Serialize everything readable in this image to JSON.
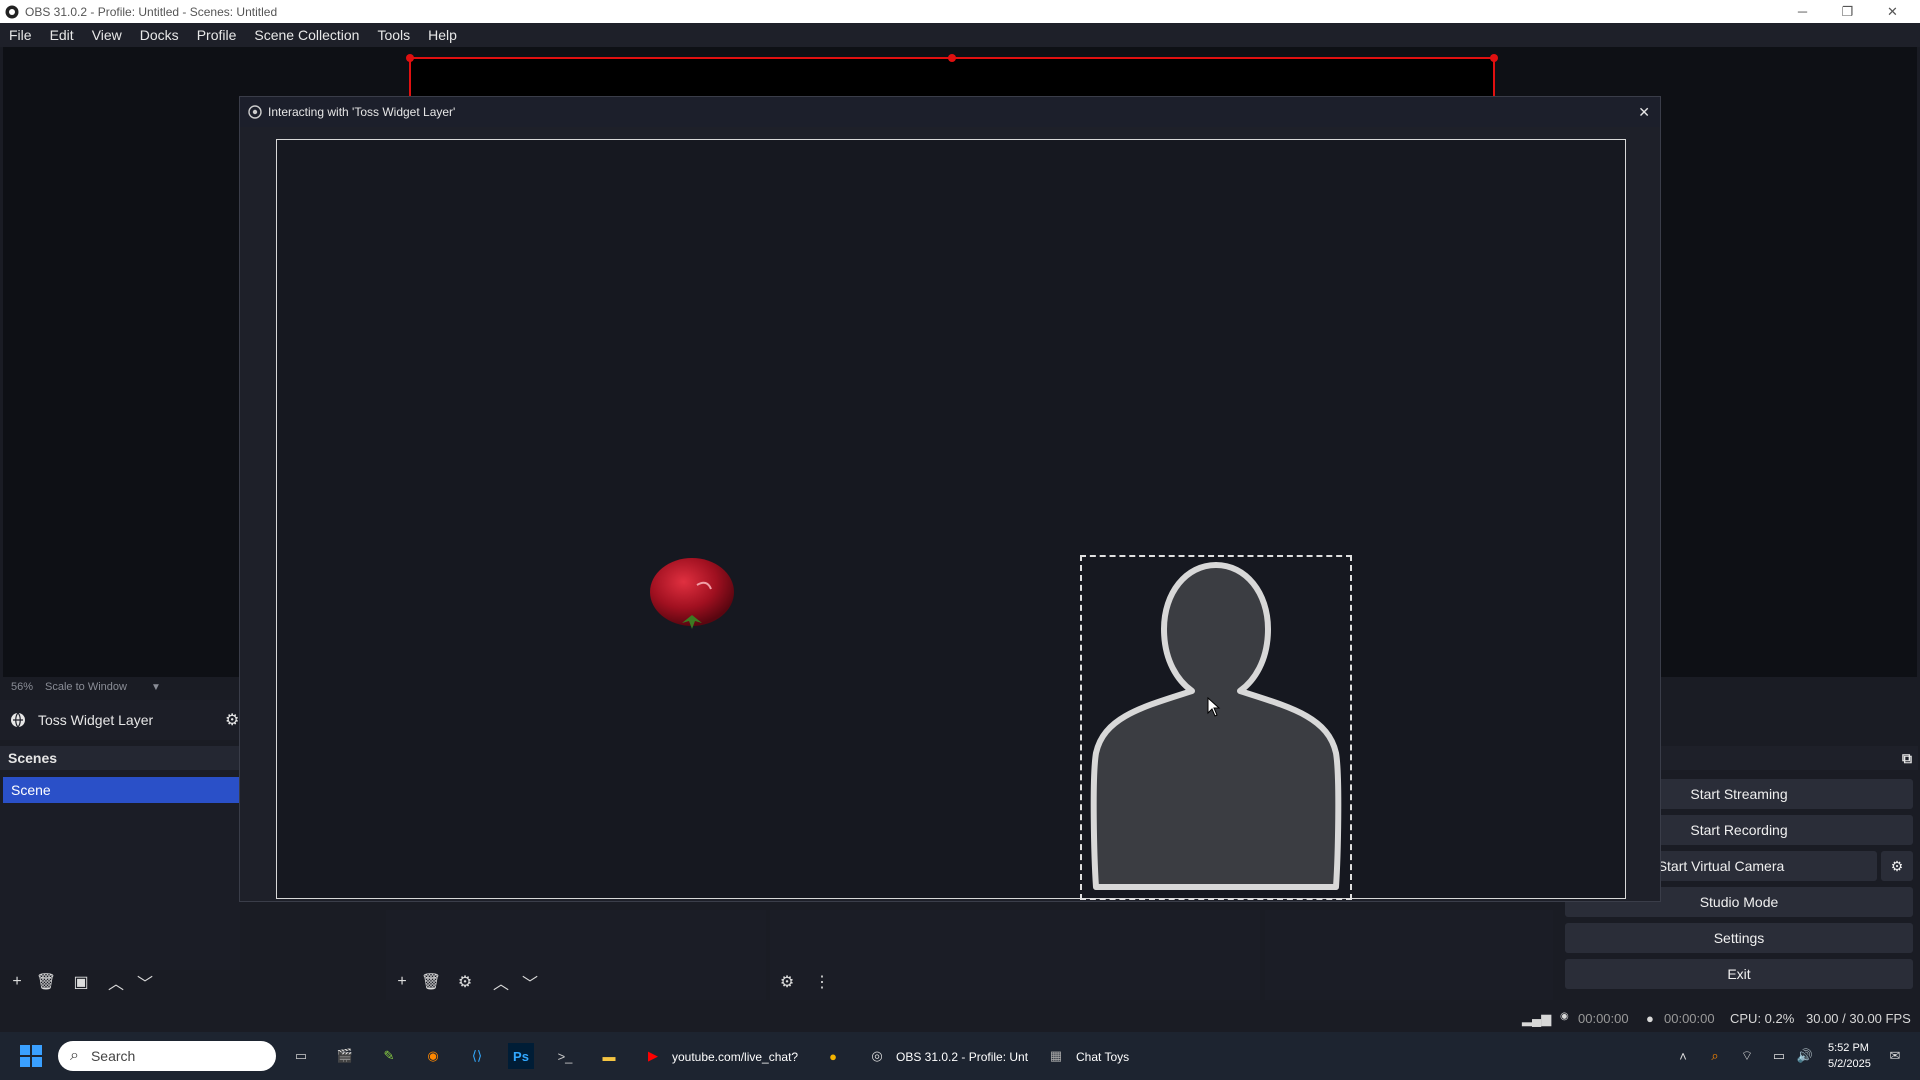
{
  "window": {
    "title": "OBS 31.0.2 - Profile: Untitled - Scenes: Untitled",
    "minimize": "─",
    "maximize": "❐",
    "close": "✕"
  },
  "menu": [
    "File",
    "Edit",
    "View",
    "Docks",
    "Profile",
    "Scene Collection",
    "Tools",
    "Help"
  ],
  "preview": {
    "zoom": "56%",
    "scale_mode": "Scale to Window"
  },
  "source_bar": {
    "name": "Toss Widget Layer"
  },
  "scenes": {
    "header": "Scenes",
    "items": [
      "Scene"
    ]
  },
  "controls": {
    "start_streaming": "Start Streaming",
    "start_recording": "Start Recording",
    "start_virtual_camera": "Start Virtual Camera",
    "studio_mode": "Studio Mode",
    "settings": "Settings",
    "exit": "Exit"
  },
  "status": {
    "stream_time": "00:00:00",
    "record_time": "00:00:00",
    "cpu": "CPU: 0.2%",
    "fps": "30.00 / 30.00 FPS"
  },
  "dialog": {
    "title": "Interacting with 'Toss Widget Layer'",
    "close": "✕"
  },
  "taskbar": {
    "search_placeholder": "Search",
    "youtube": "youtube.com/live_chat?",
    "obs": "OBS 31.0.2 - Profile: Unt",
    "chat_toys": "Chat Toys",
    "time": "5:52 PM",
    "date": "5/2/2025"
  },
  "colors": {
    "accent": "#2a50c8",
    "selection": "#e01010"
  }
}
